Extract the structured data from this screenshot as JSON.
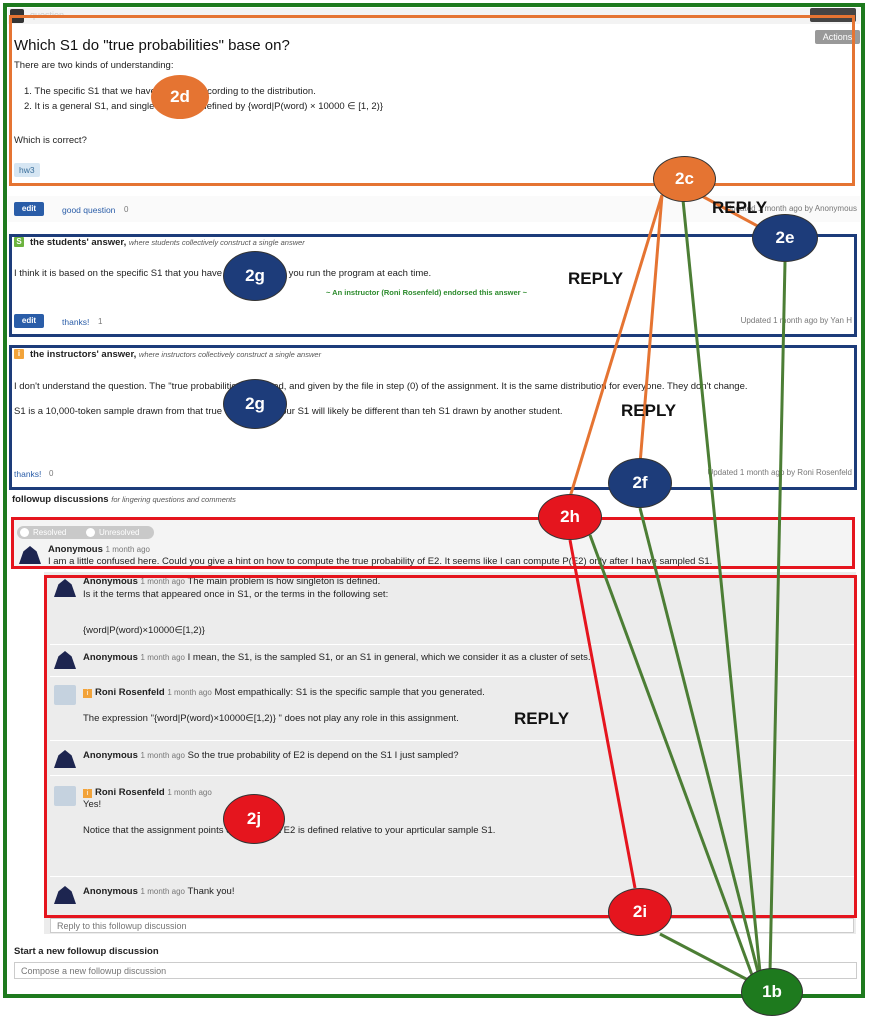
{
  "topbar": {
    "title": "question"
  },
  "question": {
    "actions_label": "Actions",
    "title": "Which S1 do \"true probabilities\" base on?",
    "intro": "There are two kinds of understanding:",
    "item1": "1. The specific S1 that we have sampled according to the distribution.",
    "item2": "2. It is a general S1, and single words are defined by {word|P(word) × 10000 ∈ [1, 2)}",
    "question_line": "Which is correct?",
    "tag": "hw3",
    "edit_label": "edit",
    "good_question_label": "good question",
    "good_question_count": "0",
    "updated": "Updated 1 month ago by Anonymous"
  },
  "students_answer": {
    "icon_letter": "S",
    "heading": "the students' answer,",
    "subheading": "where students collectively construct a single answer",
    "body": "I think it is based on the specific S1 that you have sampled when you run the program at each time.",
    "endorsement": "~ An instructor (Roni Rosenfeld) endorsed this answer ~",
    "edit_label": "edit",
    "thanks_label": "thanks!",
    "thanks_count": "1",
    "updated": "Updated 1 month ago by Yan H"
  },
  "instructors_answer": {
    "icon_letter": "i",
    "heading": "the instructors' answer,",
    "subheading": "where instructors collectively construct a single answer",
    "body1": "I don't understand the question. The \"true probabilities\" are fixed, and given by the file in step (0) of the assignment. It is the same distribution for everyone. They don't change.",
    "body2": "S1 is a 10,000-token sample drawn from that true distribution. Your S1 will likely be different than teh S1 drawn by another student.",
    "thanks_label": "thanks!",
    "thanks_count": "0",
    "updated": "Updated 1 month ago by Roni Rosenfeld"
  },
  "followup": {
    "heading": "followup discussions",
    "subheading": "for lingering questions and comments",
    "resolved_label": "Resolved",
    "unresolved_label": "Unresolved",
    "main_author": "Anonymous",
    "main_time": "1 month ago",
    "main_text": "I am a little confused here. Could you give a hint on how to compute the true probability of E2. It seems like I can compute P(E2) only after I have sampled S1.",
    "replies": [
      {
        "author": "Anonymous",
        "time": "1 month ago",
        "text": "The main problem is how singleton is defined.",
        "text2": "Is it the terms that appeared once in S1, or the terms in the following set:",
        "text3": "{word|P(word)×10000∈[1,2)}"
      },
      {
        "author": "Anonymous",
        "time": "1 month ago",
        "text": "I mean, the S1, is the sampled S1, or an S1 in general, which we consider it as a cluster of sets."
      },
      {
        "author": "Roni Rosenfeld",
        "time": "1 month ago",
        "text": "Most empathically: S1 is the specific sample that you generated.",
        "text2": "The expression \"{word|P(word)×10000∈[1,2)} \" does not play any role in this assignment."
      },
      {
        "author": "Anonymous",
        "time": "1 month ago",
        "text": "So the true probability of E2 is depend on the S1 I just sampled?"
      },
      {
        "author": "Roni Rosenfeld",
        "time": "1 month ago",
        "text": "Yes!",
        "text2": "Notice that the assignment points out the event E2 is defined relative to your aprticular sample S1."
      },
      {
        "author": "Anonymous",
        "time": "1 month ago",
        "text": "Thank you!"
      }
    ],
    "reply_placeholder": "Reply to this followup discussion",
    "new_heading": "Start a new followup discussion",
    "new_placeholder": "Compose a new followup discussion"
  },
  "annotations": {
    "c2d": "2d",
    "c2c": "2c",
    "c2e": "2e",
    "c2g_a": "2g",
    "c2g_b": "2g",
    "c2f": "2f",
    "c2h": "2h",
    "c2j": "2j",
    "c2i": "2i",
    "c1b": "1b",
    "reply1": "REPLY",
    "reply2": "REPLY",
    "reply3": "REPLY",
    "reply4": "REPLY"
  },
  "colors": {
    "orange": "#e57432",
    "navy": "#1d3c7a",
    "red": "#e5151e",
    "green": "#1e7a1e",
    "line_green": "#4c7e35"
  }
}
